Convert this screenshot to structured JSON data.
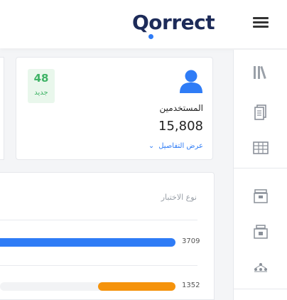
{
  "header": {
    "logo_text": "Qorrect",
    "menu_icon": "hamburger-menu-icon"
  },
  "sidebar": {
    "items": [
      {
        "icon": "library-icon"
      },
      {
        "icon": "documents-icon"
      },
      {
        "icon": "table-icon"
      },
      {
        "icon": "archive-box-icon"
      },
      {
        "icon": "archive-box-locked-icon"
      },
      {
        "icon": "hierarchy-icon"
      }
    ]
  },
  "stat_card": {
    "badge_count": "48",
    "badge_label": "جديد",
    "title": "المستخدمين",
    "value": "15,808",
    "details_link": "عرض التفاصيل",
    "icon": "user-icon"
  },
  "chart_panel": {
    "title": "نوع الاختبار"
  },
  "chart_data": {
    "type": "bar",
    "orientation": "horizontal",
    "title": "نوع الاختبار",
    "categories": [
      "",
      ""
    ],
    "values": [
      3709,
      1352
    ],
    "colors": [
      "#2f7cf6",
      "#f5930c"
    ]
  },
  "colors": {
    "brand": "#1d2b59",
    "accent": "#2f7cf6",
    "success": "#3fb366",
    "warning": "#f5930c"
  }
}
